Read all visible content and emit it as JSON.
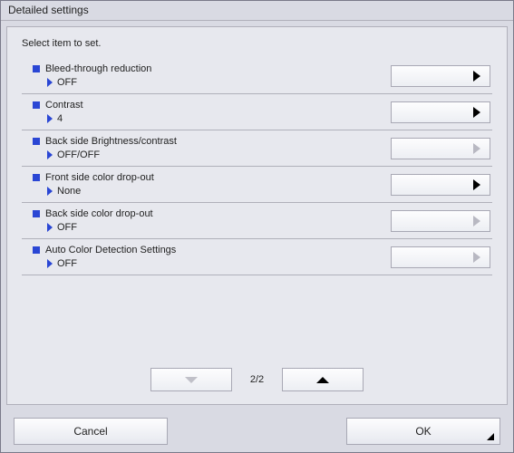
{
  "window": {
    "title": "Detailed settings"
  },
  "instruction": "Select item to set.",
  "items": [
    {
      "label": "Bleed-through reduction",
      "value": "OFF",
      "enabled": true
    },
    {
      "label": "Contrast",
      "value": "4",
      "enabled": true
    },
    {
      "label": "Back side Brightness/contrast",
      "value": "OFF/OFF",
      "enabled": false
    },
    {
      "label": "Front side color drop-out",
      "value": "None",
      "enabled": true
    },
    {
      "label": "Back side color drop-out",
      "value": "OFF",
      "enabled": false
    },
    {
      "label": "Auto Color Detection Settings",
      "value": "OFF",
      "enabled": false
    }
  ],
  "pager": {
    "indicator": "2/2",
    "prev_enabled": true,
    "next_enabled": false
  },
  "footer": {
    "cancel": "Cancel",
    "ok": "OK"
  }
}
